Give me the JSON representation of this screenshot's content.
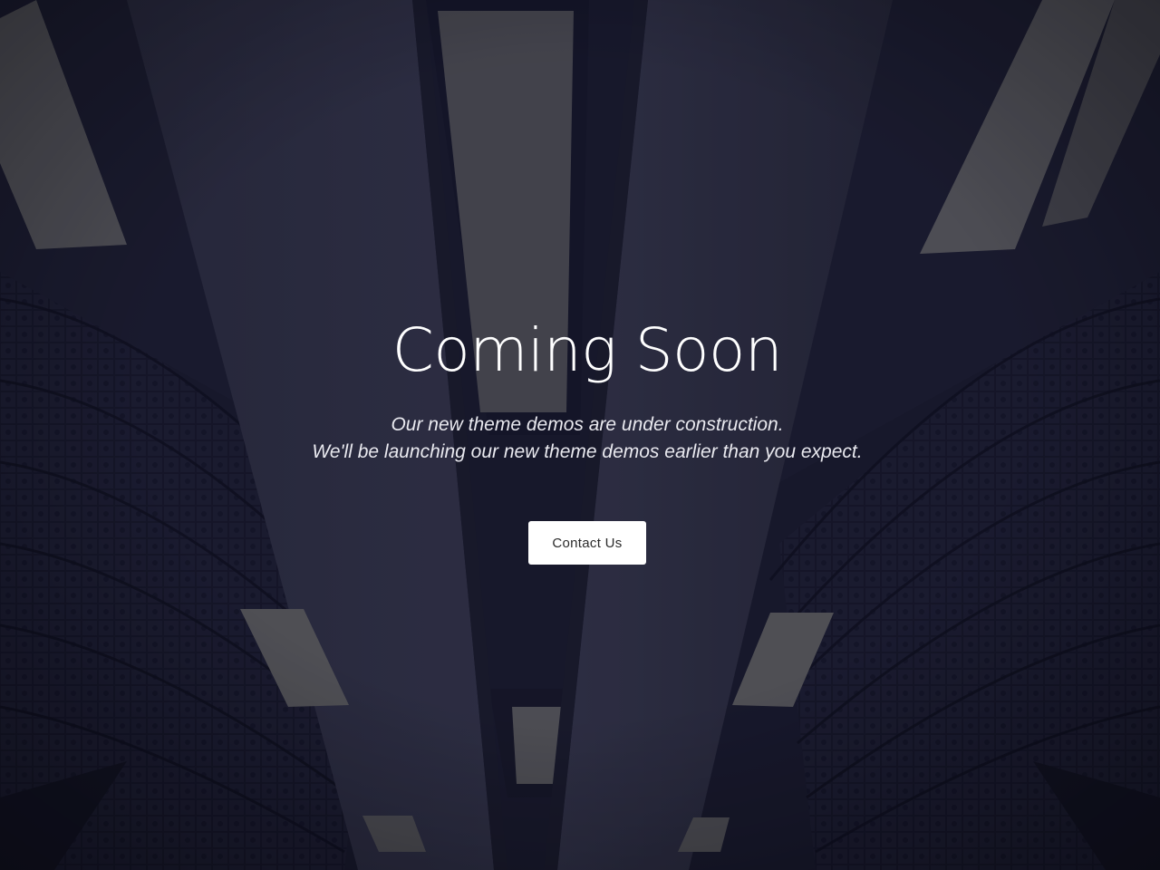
{
  "hero": {
    "title": "Coming Soon",
    "subtitle_line1": "Our new theme demos are under construction.",
    "subtitle_line2": "We'll be launching our new theme demos earlier than you expect.",
    "cta_label": "Contact Us"
  },
  "colors": {
    "background": "#15162a",
    "text": "#ffffff",
    "button_bg": "#ffffff",
    "button_text": "#2b2b2b"
  }
}
